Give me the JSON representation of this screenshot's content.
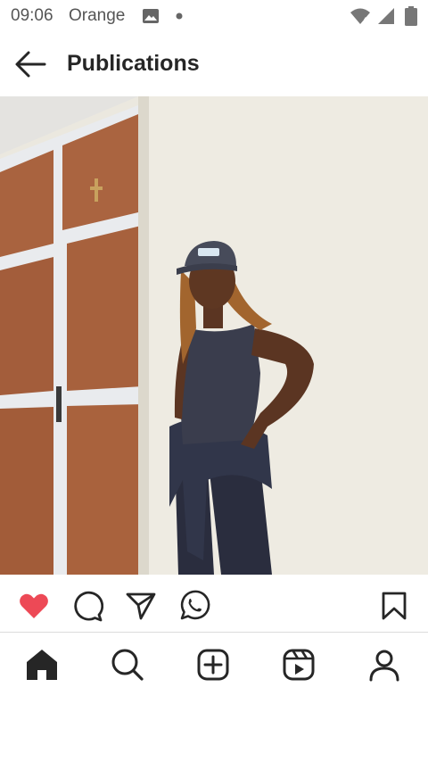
{
  "status_bar": {
    "time": "09:06",
    "carrier": "Orange",
    "icons": [
      "gallery-icon",
      "dot-icon",
      "wifi-icon",
      "signal-icon",
      "battery-icon"
    ]
  },
  "header": {
    "title": "Publications",
    "back_icon": "arrow-left-icon"
  },
  "post": {
    "image_alt": "photo",
    "liked": true,
    "actions": [
      "heart-icon",
      "comment-icon",
      "share-icon",
      "whatsapp-icon",
      "bookmark-icon"
    ]
  },
  "bottom_nav": {
    "items": [
      "home-icon",
      "search-icon",
      "create-icon",
      "reels-icon",
      "profile-icon"
    ],
    "active": "home-icon"
  },
  "colors": {
    "like_red": "#ed4956",
    "text": "#262626",
    "status_gray": "#555555",
    "divider": "#dbdbdb"
  }
}
